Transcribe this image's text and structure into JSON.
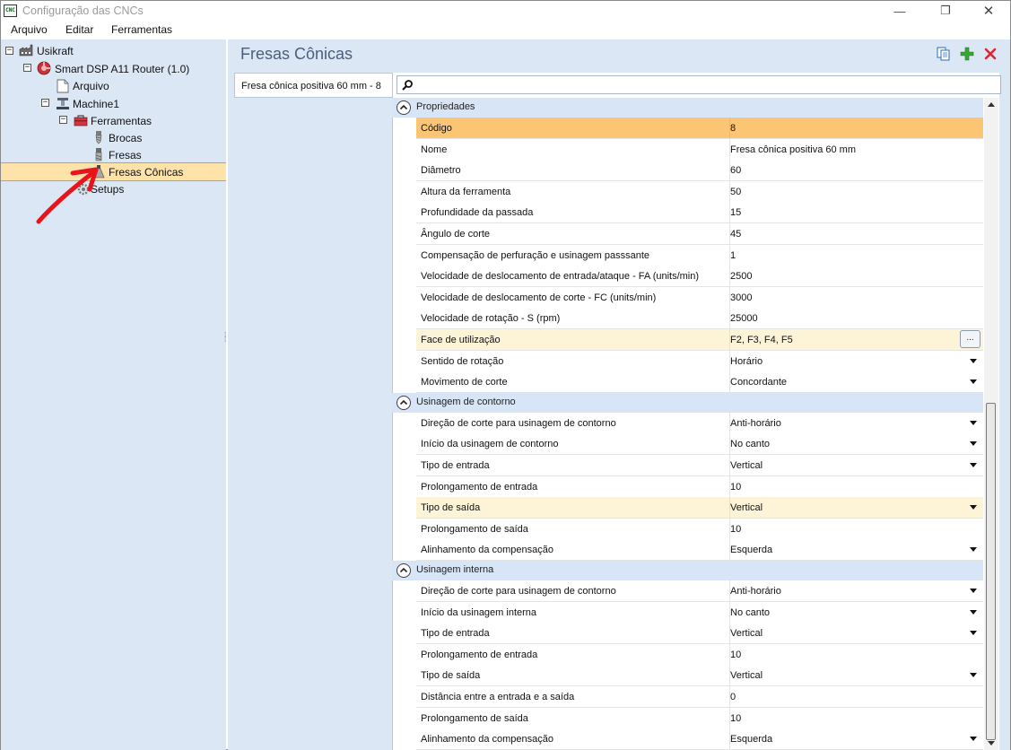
{
  "window": {
    "title": "Configuração das CNCs",
    "icon_text": "CNC",
    "buttons": {
      "minimize": "—",
      "maximize": "❐",
      "close": "✕"
    }
  },
  "menu": {
    "items": [
      "Arquivo",
      "Editar",
      "Ferramentas"
    ]
  },
  "tree": {
    "nodes": [
      {
        "label": "Usikraft",
        "icon": "factory-icon"
      },
      {
        "label": "Smart DSP A11 Router (1.0)",
        "icon": "router-icon"
      },
      {
        "label": "Arquivo",
        "icon": "document-icon"
      },
      {
        "label": "Machine1",
        "icon": "machine-icon"
      },
      {
        "label": "Ferramentas",
        "icon": "toolbox-icon"
      },
      {
        "label": "Brocas",
        "icon": "drill-bit-icon"
      },
      {
        "label": "Fresas",
        "icon": "end-mill-icon"
      },
      {
        "label": "Fresas Cônicas",
        "icon": "conical-mill-icon",
        "selected": true
      },
      {
        "label": "Setups",
        "icon": "gear-icon"
      }
    ],
    "expander_minus": "−"
  },
  "panel": {
    "title": "Fresas Cônicas",
    "tab_label": "Fresa cônica positiva 60 mm - 8",
    "toolbar": [
      "copy-icon",
      "add-icon",
      "delete-icon"
    ],
    "colors": {
      "add": "#3aa537",
      "delete": "#e1252b"
    }
  },
  "grid": {
    "categories": [
      {
        "label": "Propriedades",
        "rows": [
          {
            "name": "Código",
            "value": "8",
            "highlight": "orange"
          },
          {
            "name": "Nome",
            "value": "Fresa cônica positiva 60 mm"
          },
          {
            "name": "Diâmetro",
            "value": "60"
          },
          {
            "name": "Altura da ferramenta",
            "value": "50"
          },
          {
            "name": "Profundidade da passada",
            "value": "15"
          },
          {
            "name": "Ângulo de corte",
            "value": "45"
          },
          {
            "name": "Compensação de perfuração e usinagem passsante",
            "value": "1"
          },
          {
            "name": "Velocidade de deslocamento de entrada/ataque - FA (units/min)",
            "value": "2500"
          },
          {
            "name": "Velocidade de deslocamento de corte - FC (units/min)",
            "value": "3000"
          },
          {
            "name": "Velocidade de rotação - S (rpm)",
            "value": "25000"
          },
          {
            "name": "Face de utilização",
            "value": "F2, F3, F4, F5",
            "highlight": "yellow",
            "ellipsis": "..."
          },
          {
            "name": "Sentido de rotação",
            "value": "Horário",
            "dropdown": true
          },
          {
            "name": "Movimento de corte",
            "value": "Concordante",
            "dropdown": true
          }
        ]
      },
      {
        "label": "Usinagem de contorno",
        "rows": [
          {
            "name": "Direção de corte para usinagem de contorno",
            "value": "Anti-horário",
            "dropdown": true
          },
          {
            "name": "Início da usinagem de contorno",
            "value": "No canto",
            "dropdown": true
          },
          {
            "name": "Tipo de entrada",
            "value": "Vertical",
            "dropdown": true
          },
          {
            "name": "Prolongamento de entrada",
            "value": "10"
          },
          {
            "name": "Tipo de saída",
            "value": "Vertical",
            "dropdown": true,
            "highlight": "yellow"
          },
          {
            "name": "Prolongamento de saída",
            "value": "10"
          },
          {
            "name": "Alinhamento da compensação",
            "value": "Esquerda",
            "dropdown": true
          }
        ]
      },
      {
        "label": "Usinagem interna",
        "rows": [
          {
            "name": "Direção de corte para usinagem de contorno",
            "value": "Anti-horário",
            "dropdown": true
          },
          {
            "name": "Início da usinagem interna",
            "value": "No canto",
            "dropdown": true
          },
          {
            "name": "Tipo de entrada",
            "value": "Vertical",
            "dropdown": true
          },
          {
            "name": "Prolongamento de entrada",
            "value": "10"
          },
          {
            "name": "Tipo de saída",
            "value": "Vertical",
            "dropdown": true
          },
          {
            "name": "Distância entre a entrada e a saída",
            "value": "0"
          },
          {
            "name": "Prolongamento de saída",
            "value": "10"
          },
          {
            "name": "Alinhamento da compensação",
            "value": "Esquerda",
            "dropdown": true
          }
        ]
      }
    ]
  },
  "annotation": {
    "color": "#e8141b"
  }
}
